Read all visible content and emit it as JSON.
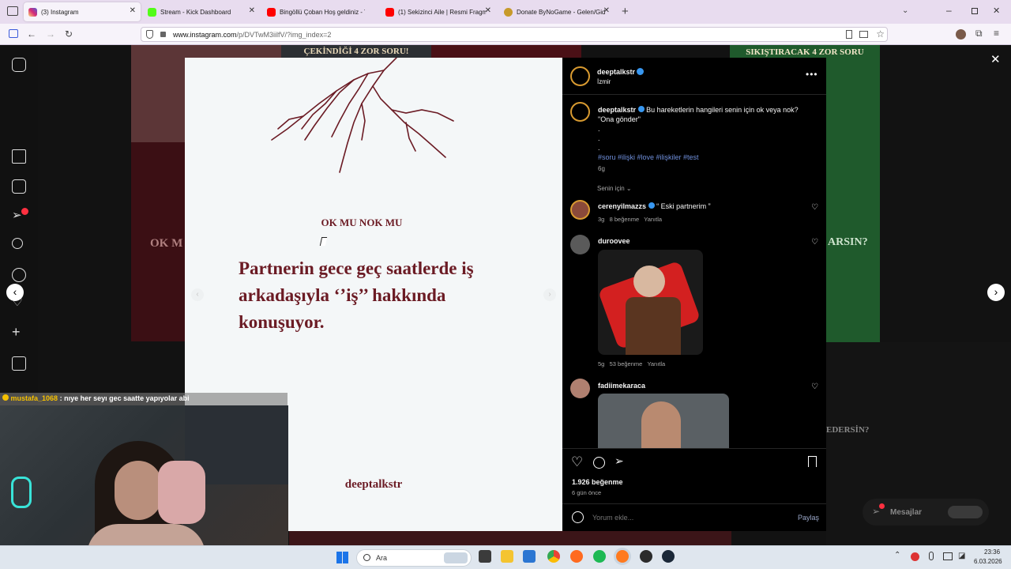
{
  "tabs": [
    {
      "title": "(3) Instagram",
      "favicon_color": "#dd2a7b"
    },
    {
      "title": "Stream - Kick Dashboard",
      "favicon_color": "#53fc18"
    },
    {
      "title": "Bingöllü Çoban Hoş geldiniz - Y",
      "favicon_color": "#ff0000"
    },
    {
      "title": "(1) Sekizinci Aile | Resmi Fragm",
      "favicon_color": "#ff0000"
    },
    {
      "title": "Donate ByNoGame - Gelen/Gid",
      "favicon_color": "#c79a2a"
    }
  ],
  "url": {
    "host": "www.instagram.com",
    "path": "/p/DVTwM3iilfV/?img_index=2"
  },
  "post_image": {
    "label": "OK MU NOK MU",
    "question": "Partnerin gece geç saatlerde iş arkadaşıyla ‘’iş’’ hakkında konuşuyor.",
    "brand": "deeptalkstr"
  },
  "post": {
    "username": "deeptalkstr",
    "location": "İzmir",
    "caption_user": "deeptalkstr",
    "caption_text": "Bu hareketlerin hangileri senin için ok veya nok?",
    "caption_line2": "\"Ona gönder\"",
    "hashtags": "#soru #ilişki #love #ilişkiler #test",
    "caption_age": "6g",
    "filter": "Senin için",
    "likes": "1.926 beğenme",
    "posted": "6 gün önce",
    "comment_placeholder": "Yorum ekle...",
    "share_label": "Paylaş"
  },
  "comments": [
    {
      "user": "cerenyilmazzs",
      "text": "“ Eski partnerim ”",
      "age": "3g",
      "likes": "8 beğenme",
      "reply": "Yanıtla"
    },
    {
      "user": "duroovee",
      "text": "",
      "age": "5g",
      "likes": "53 beğenme",
      "reply": "Yanıtla"
    },
    {
      "user": "fadiimekaracа",
      "text": "",
      "age": "",
      "likes": "",
      "reply": ""
    }
  ],
  "background_cards": {
    "card1_title": "ÇEKİNDİĞİ 4 ZOR SORU!",
    "card2_title": "SIKIŞTIRACAK 4 ZOR SORU",
    "left_text": "OK M",
    "right_text": "ARSIN?",
    "right_text2": "EDERSİN?"
  },
  "chat_overlay": {
    "user": "mustafa_1068",
    "message": ": nıye her seyı gec saatte yapıyolar abi"
  },
  "messages_label": "Mesajlar",
  "taskbar": {
    "search": "Ara",
    "time": "23:36",
    "date": "6.03.2026"
  },
  "colors": {
    "brand_red": "#6b1b24",
    "verified": "#3897f0",
    "ring": "#d89a30"
  }
}
